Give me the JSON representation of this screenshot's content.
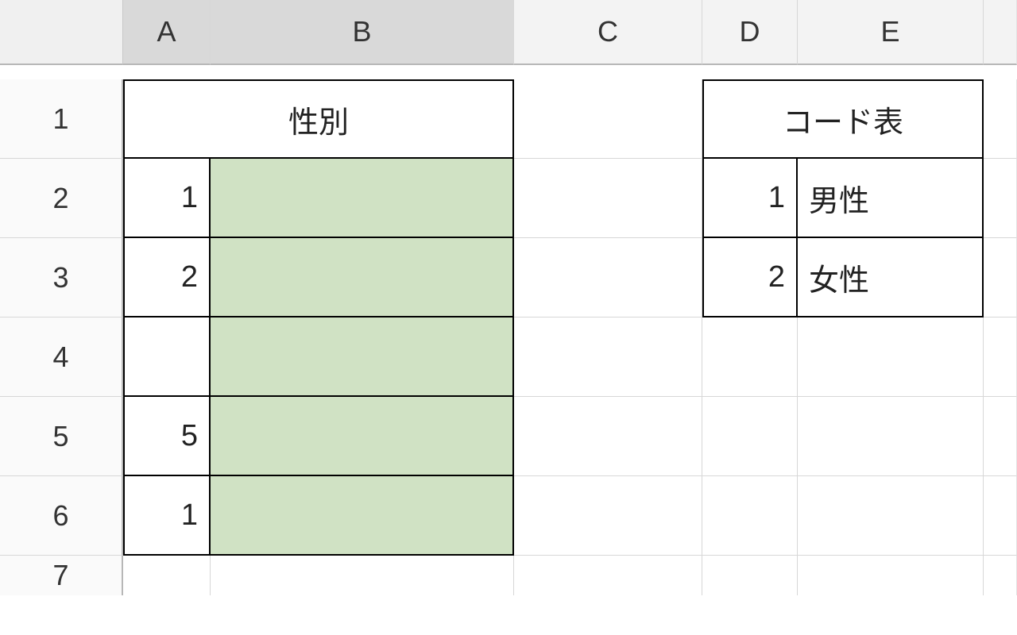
{
  "columns": {
    "A": "A",
    "B": "B",
    "C": "C",
    "D": "D",
    "E": "E"
  },
  "rows": {
    "1": "1",
    "2": "2",
    "3": "3",
    "4": "4",
    "5": "5",
    "6": "6",
    "7": "7"
  },
  "leftTable": {
    "header": "性別",
    "rows": [
      {
        "code": "1",
        "label": ""
      },
      {
        "code": "2",
        "label": ""
      },
      {
        "code": "",
        "label": ""
      },
      {
        "code": "5",
        "label": ""
      },
      {
        "code": "1",
        "label": ""
      }
    ]
  },
  "rightTable": {
    "header": "コード表",
    "rows": [
      {
        "code": "1",
        "label": "男性"
      },
      {
        "code": "2",
        "label": "女性"
      }
    ]
  },
  "colors": {
    "fill_green": "#d0e2c4",
    "header_grey": "#d9d9d9"
  }
}
